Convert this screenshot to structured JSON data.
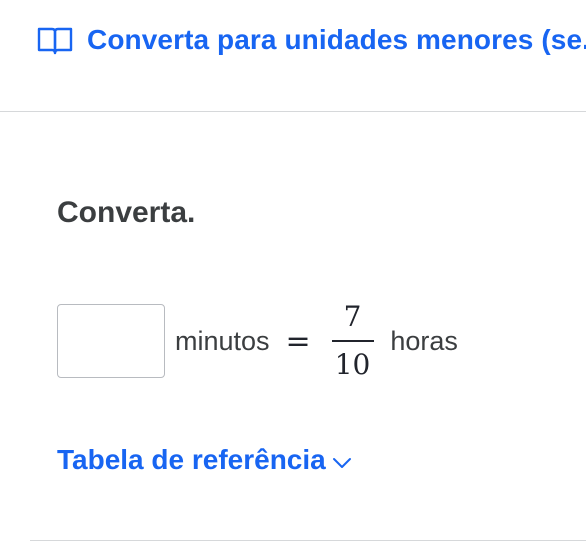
{
  "header": {
    "icon": "book-icon",
    "title": "Converta para unidades menores (se..."
  },
  "question": {
    "prompt": "Converta."
  },
  "equation": {
    "answer_value": "",
    "left_unit": "minutos",
    "equals_sign": "=",
    "numerator": "7",
    "denominator": "10",
    "right_unit": "horas"
  },
  "reference": {
    "label": "Tabela de referência",
    "icon": "chevron-down-icon"
  },
  "colors": {
    "accent": "#1865f2",
    "text": "#3b3e40",
    "divider": "#d6d8da"
  }
}
